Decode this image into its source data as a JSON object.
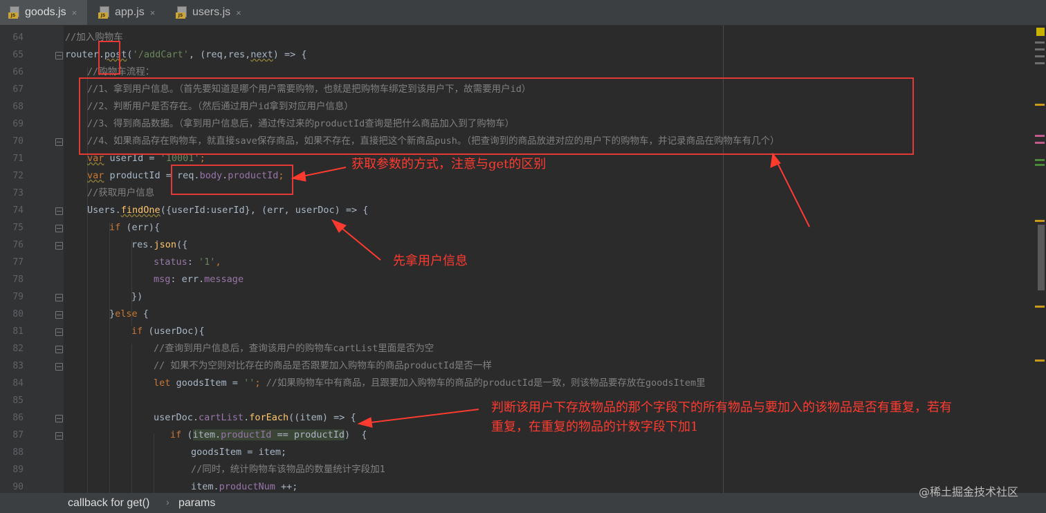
{
  "tabs": [
    {
      "label": "goods.js",
      "close": "×",
      "icon": "js-file-icon",
      "active": true
    },
    {
      "label": "app.js",
      "close": "×",
      "icon": "js-file-icon",
      "active": false
    },
    {
      "label": "users.js",
      "close": "×",
      "icon": "js-file-icon",
      "active": false
    }
  ],
  "line_numbers": [
    "64",
    "65",
    "66",
    "67",
    "68",
    "69",
    "70",
    "71",
    "72",
    "73",
    "74",
    "75",
    "76",
    "77",
    "78",
    "79",
    "80",
    "81",
    "82",
    "83",
    "84",
    "85",
    "86",
    "87",
    "88",
    "89",
    "90"
  ],
  "code": {
    "l64": "//加入购物车",
    "l65_a": "router.",
    "l65_b": "post",
    "l65_c": "(",
    "l65_d": "'/addCart'",
    "l65_e": ", (req,res,",
    "l65_f": "next",
    "l65_g": ") => {",
    "l66": "//购物车流程：",
    "l67": "//1、拿到用户信息。（首先要知道是哪个用户需要购物，也就是把购物车绑定到该用户下，故需要用户id）",
    "l68": "//2、判断用户是否存在。（然后通过用户id拿到对应用户信息）",
    "l69": "//3、得到商品数据。（拿到用户信息后，通过传过来的productId查询是把什么商品加入到了购物车）",
    "l70": "//4、如果商品存在购物车，就直接save保存商品，如果不存在，直接把这个新商品push。（把查询到的商品放进对应的用户下的购物车，并记录商品在购物车有几个）",
    "l71_a": "var",
    "l71_b": " userId = ",
    "l71_c": "'10001'",
    "l71_d": ";",
    "l72_a": "var",
    "l72_b": " productId = req.",
    "l72_c": "body",
    "l72_d": ".",
    "l72_e": "productId",
    "l72_f": ";",
    "l73": "//获取用户信息",
    "l74_a": "Users.",
    "l74_b": "findOne",
    "l74_c": "({userId:userId}, (err, userDoc) => {",
    "l75_a": "if",
    "l75_b": " (err){",
    "l76_a": "res.",
    "l76_b": "json",
    "l76_c": "({",
    "l77_a": "status",
    "l77_b": ": ",
    "l77_c": "'1'",
    "l77_d": ",",
    "l78_a": "msg",
    "l78_b": ": err.",
    "l78_c": "message",
    "l79": "})",
    "l80_a": "}",
    "l80_b": "else",
    "l80_c": " {",
    "l81_a": "if",
    "l81_b": " (userDoc){",
    "l82": "//查询到用户信息后，查询该用户的购物车cartList里面是否为空",
    "l83": "// 如果不为空则对比存在的商品是否跟要加入购物车的商品productId是否一样",
    "l84_a": "let",
    "l84_b": " goodsItem = ",
    "l84_c": "''",
    "l84_d": "; ",
    "l84_e": "//如果购物车中有商品，且跟要加入购物车的商品的productId是一致，则该物品要存放在goodsItem里",
    "l86_a": "userDoc.",
    "l86_b": "cartList",
    "l86_c": ".",
    "l86_d": "forEach",
    "l86_e": "((item) => {",
    "l87_a": "if",
    "l87_b": " (",
    "l87_c": "item.",
    "l87_d": "productId",
    "l87_e": " == productId",
    "l87_f": ")  {",
    "l88": "goodsItem = item;",
    "l89": "//同时，统计购物车该物品的数量统计字段加1",
    "l90_a": "item.",
    "l90_b": "productNum",
    "l90_c": " ++;"
  },
  "annotations": {
    "params": "获取参数的方式，注意与get的区别",
    "user_info": "先拿用户信息",
    "duplicate_line1": "判断该用户下存放物品的那个字段下的所有物品与要加入的该物品是否有重复，若有",
    "duplicate_line2": "重复，在重复的物品的计数字段下加1"
  },
  "breadcrumb": [
    "callback for get()",
    "params"
  ],
  "breadcrumb_separator": "›",
  "watermark": "@稀土掘金技术社区",
  "colors": {
    "background": "#2b2b2b",
    "comment": "#808080",
    "keyword": "#cc7832",
    "string": "#6a8759",
    "property": "#9876aa",
    "function": "#ffc66d",
    "annotation_red": "#ff3b30"
  }
}
